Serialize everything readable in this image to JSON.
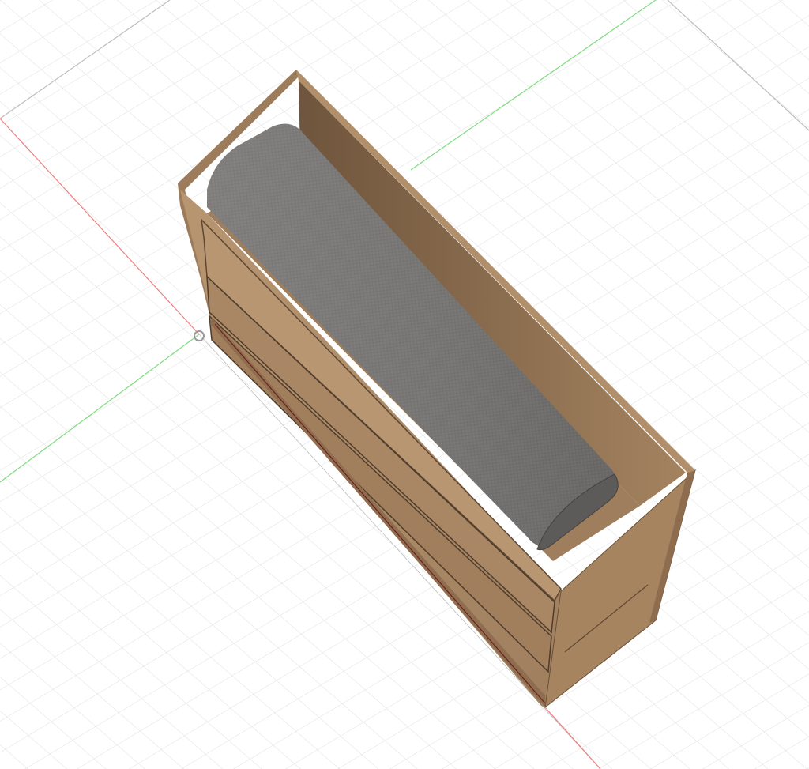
{
  "viewport": {
    "view": "3d-model-viewport",
    "background": "#ffffff"
  },
  "grid": {
    "visible": true,
    "line_color": "#d9d9d9",
    "major_line_color": "#b8b8b8"
  },
  "axes": {
    "x_axis_color": "#f08080",
    "y_axis_color": "#7fdc7f",
    "origin_marker": "circle-icon"
  },
  "model": {
    "description_icon": "box-with-rolled-cushion-icon",
    "wood_color": "#b08e6b",
    "wood_dark_color": "#8a6c4f",
    "wood_shadow_color": "#5e4733",
    "cushion_color": "#7d7b79",
    "cushion_dark_color": "#595755"
  }
}
